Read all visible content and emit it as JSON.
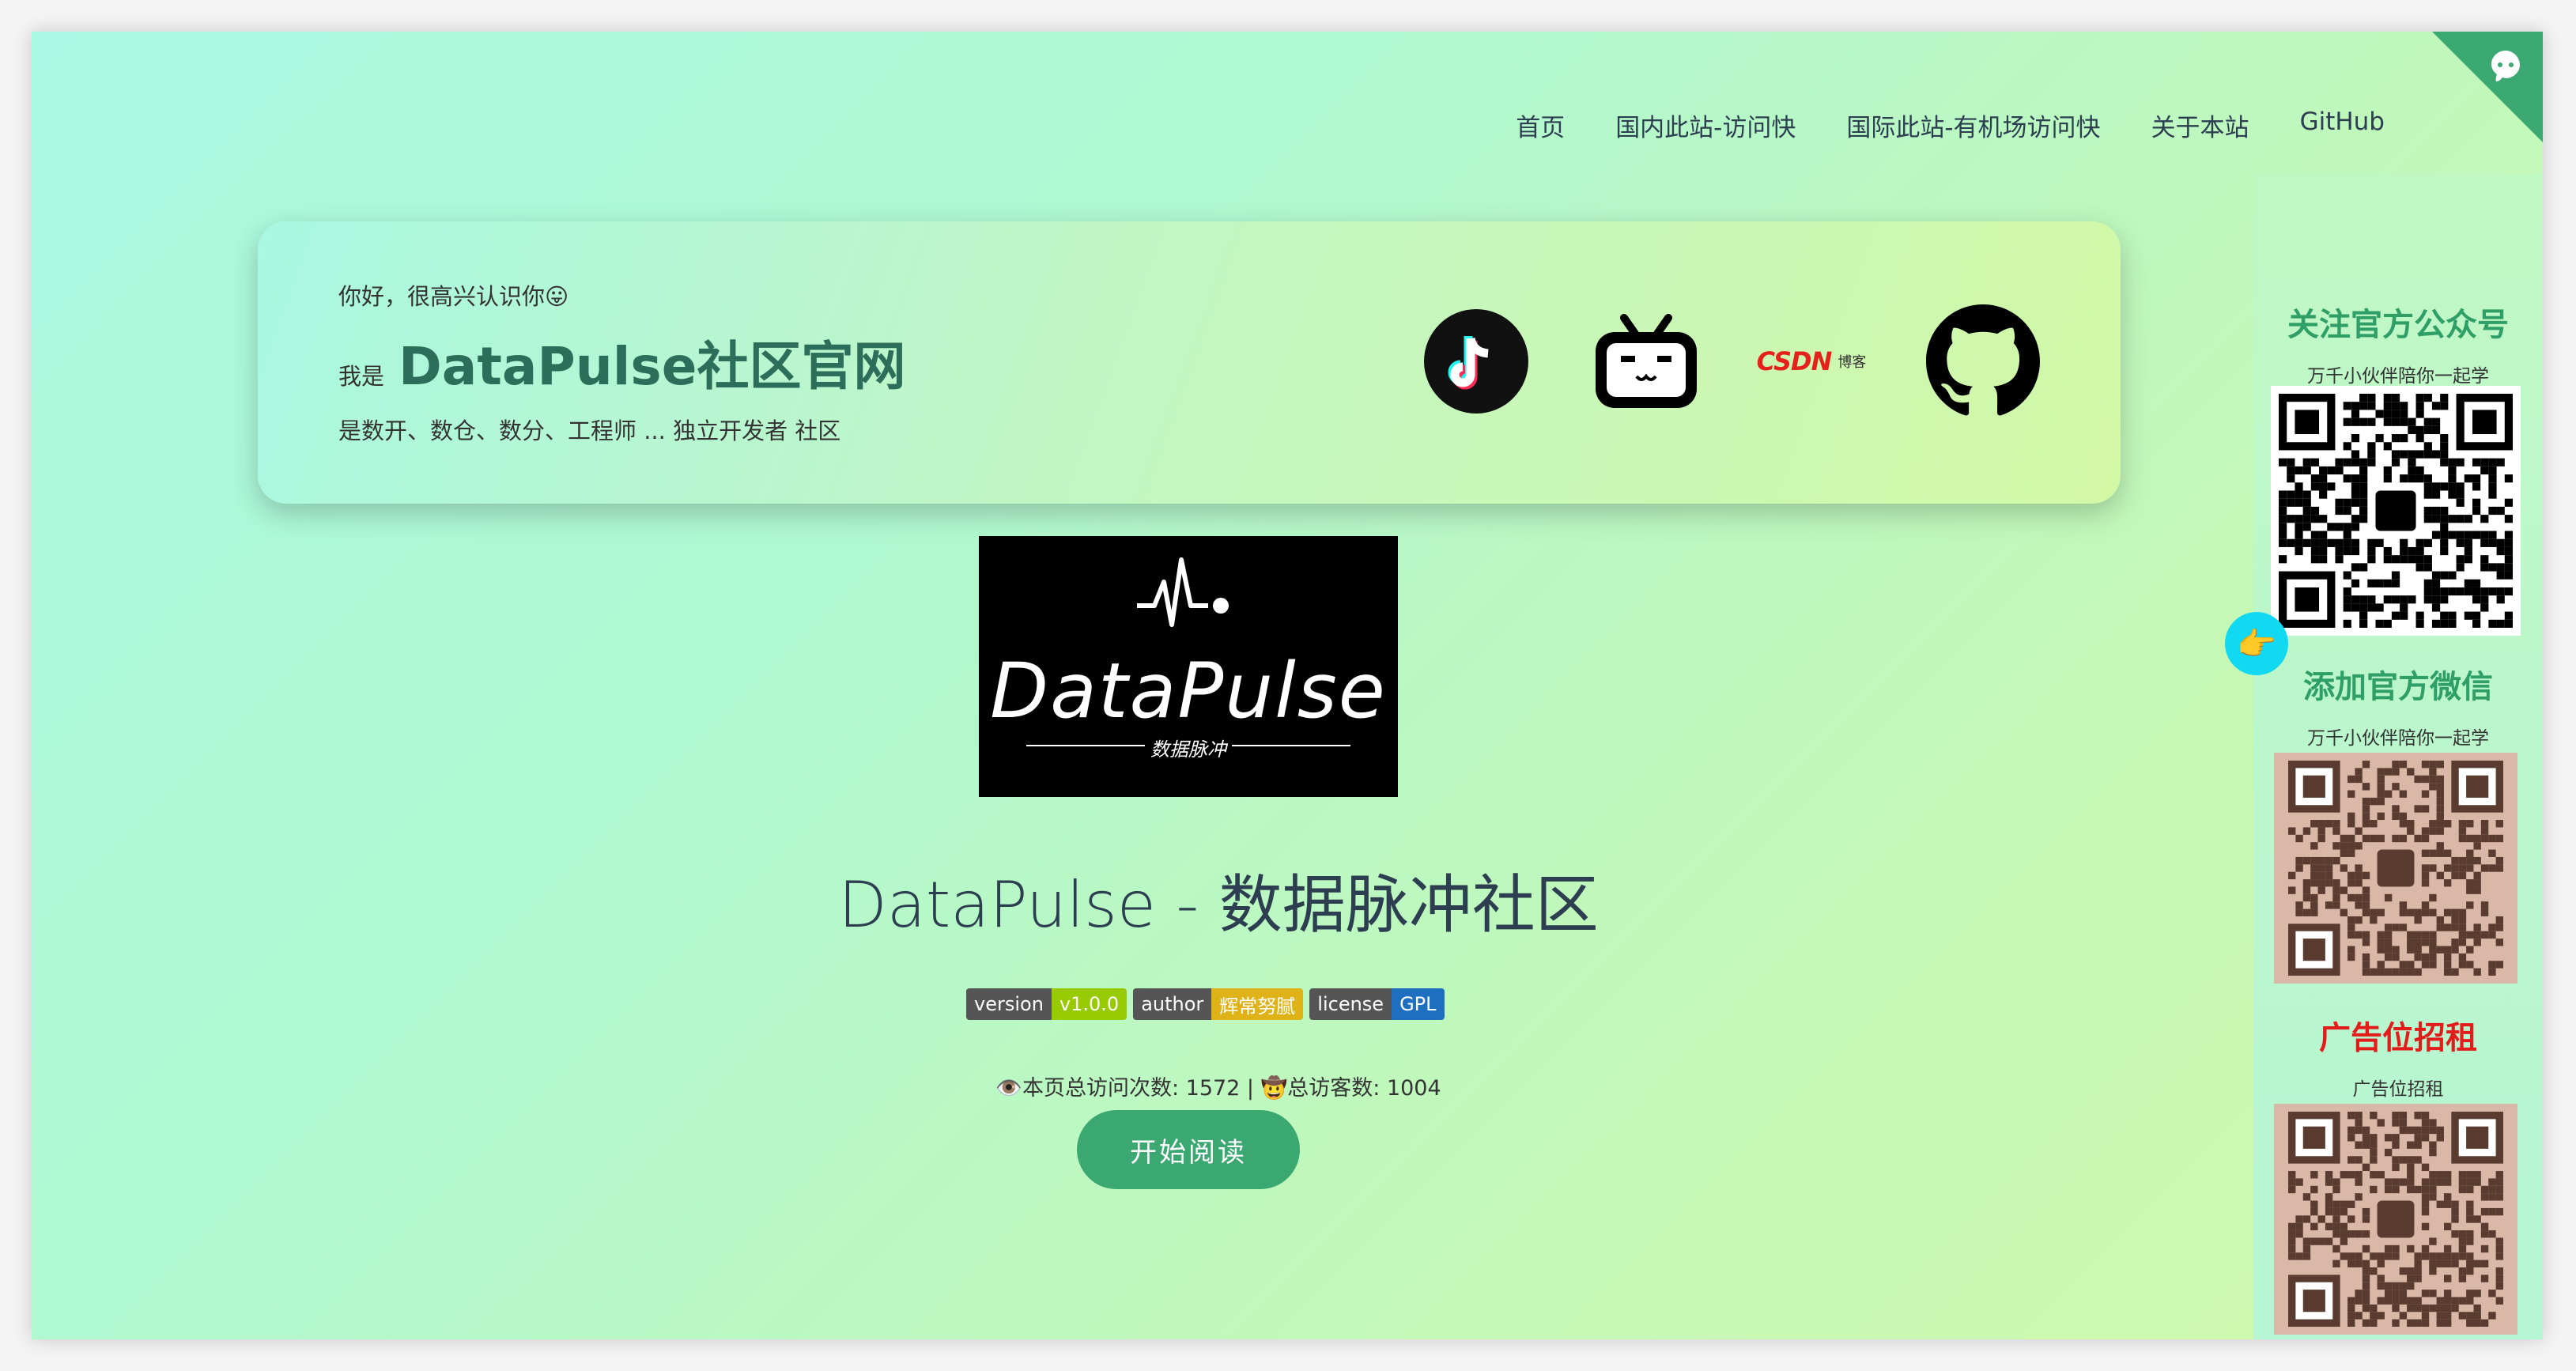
{
  "nav": {
    "items": [
      "首页",
      "国内此站-访问快",
      "国际此站-有机场访问快",
      "关于本站",
      "GitHub"
    ]
  },
  "hero": {
    "greeting": "你好，很高兴认识你😛",
    "prefix": "我是",
    "brand": "DataPulse社区官网",
    "tagline": "是数开、数仓、数分、工程师 ... 独立开发者 社区",
    "socials": [
      "tiktok-icon",
      "bilibili-icon",
      "csdn-icon",
      "github-icon"
    ],
    "csdn_text": "CSDN",
    "csdn_sub": "博客"
  },
  "logo": {
    "text": "DataPulse",
    "sub": "数据脉冲"
  },
  "title": "DataPulse - 数据脉冲社区",
  "badges": [
    {
      "label": "version",
      "value": "v1.0.0",
      "color": "#97ca00"
    },
    {
      "label": "author",
      "value": "辉常努腻",
      "color": "#dfb317"
    },
    {
      "label": "license",
      "value": "GPL",
      "color": "#1e6fbf"
    }
  ],
  "counter": "👁️本页总访问次数: 1572 | 🤠总访客数: 1004",
  "start_button": "开始阅读",
  "sidebar": {
    "s1_title": "关注官方公众号",
    "s1_sub": "万千小伙伴陪你一起学",
    "s2_title": "添加官方微信",
    "s2_sub": "万千小伙伴陪你一起学",
    "s3_title": "广告位招租",
    "s3_sub": "广告位招租",
    "pointer": "👉"
  },
  "colors": {
    "accent": "#3aa870",
    "ad": "#e21b1b",
    "brand_text": "#2c6e5a"
  }
}
